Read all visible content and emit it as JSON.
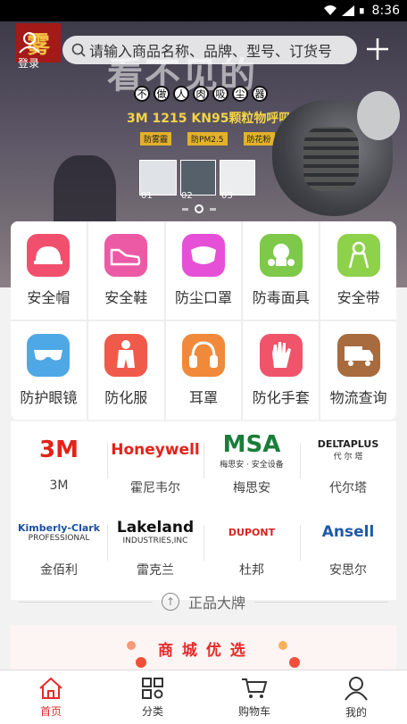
{
  "status_bar": {
    "time": "8:36",
    "icons": [
      "wifi-icon",
      "signal-icon",
      "battery-icon"
    ]
  },
  "header": {
    "logo_text": "雾",
    "login_label": "登录",
    "search_placeholder": "请输入商品名称、品牌、型号、订货号"
  },
  "banner": {
    "background_text": "看不见的",
    "tagline_chars": [
      "不",
      "做",
      "人",
      "肉",
      "吸",
      "尘",
      "器"
    ],
    "product_title": "3M 1215 KN95颗粒物呼吸套装",
    "chips": [
      "防雾霾",
      "防PM2.5",
      "防花粉"
    ],
    "thumb_numbers": [
      "01",
      "02",
      "03"
    ],
    "active_slide": 2,
    "slide_count": 3
  },
  "categories": [
    {
      "label": "安全帽",
      "icon": "hard-hat-icon",
      "color": "#f0506e"
    },
    {
      "label": "安全鞋",
      "icon": "shoe-icon",
      "color": "#ec5aa6"
    },
    {
      "label": "防尘口罩",
      "icon": "mask-icon",
      "color": "#e650d6"
    },
    {
      "label": "防毒面具",
      "icon": "gas-mask-icon",
      "color": "#7ec94a"
    },
    {
      "label": "安全带",
      "icon": "safety-belt-icon",
      "color": "#8ed14a"
    },
    {
      "label": "防护眼镜",
      "icon": "goggles-icon",
      "color": "#4fa8e6"
    },
    {
      "label": "防化服",
      "icon": "chemical-suit-icon",
      "color": "#ef5a4a"
    },
    {
      "label": "耳罩",
      "icon": "earmuff-icon",
      "color": "#f08a3a"
    },
    {
      "label": "防化手套",
      "icon": "glove-icon",
      "color": "#f0546a"
    },
    {
      "label": "物流查询",
      "icon": "truck-icon",
      "color": "#a86b3e"
    }
  ],
  "brands": [
    {
      "name": "3M",
      "logo_text": "3M",
      "logo_color": "#e4221b"
    },
    {
      "name": "霍尼韦尔",
      "logo_text": "Honeywell",
      "logo_color": "#e4221b"
    },
    {
      "name": "梅思安",
      "logo_text": "MSA",
      "logo_subtext": "梅思安 · 安全设备",
      "logo_color": "#1a7d3a"
    },
    {
      "name": "代尔塔",
      "logo_text": "DELTAPLUS",
      "logo_subtext": "代 尔 塔",
      "logo_color": "#222222"
    },
    {
      "name": "金佰利",
      "logo_text": "Kimberly-Clark",
      "logo_subtext": "PROFESSIONAL",
      "logo_color": "#1d4fa0"
    },
    {
      "name": "雷克兰",
      "logo_text": "Lakeland",
      "logo_subtext": "INDUSTRIES,INC",
      "logo_color": "#111111"
    },
    {
      "name": "杜邦",
      "logo_text": "DUPONT",
      "logo_color": "#d8231e"
    },
    {
      "name": "安思尔",
      "logo_text": "Ansell",
      "logo_color": "#1e5aa8"
    }
  ],
  "brand_section_title": "正品大牌",
  "mall_section_title": "商 城 优 选",
  "tabbar": [
    {
      "label": "首页",
      "icon": "home-icon",
      "active": true
    },
    {
      "label": "分类",
      "icon": "grid-icon",
      "active": false
    },
    {
      "label": "购物车",
      "icon": "cart-icon",
      "active": false
    },
    {
      "label": "我的",
      "icon": "user-icon",
      "active": false
    }
  ]
}
